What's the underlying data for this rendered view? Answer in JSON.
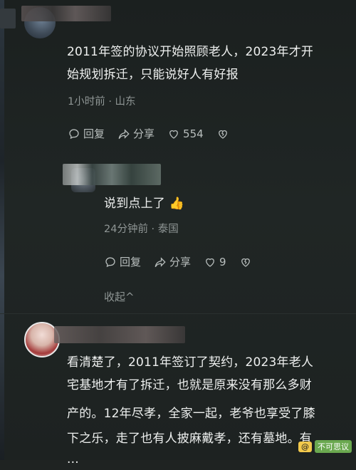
{
  "comments": [
    {
      "lines": [
        "2011年签的协议开始照顾老人，2023年才开",
        "始规划拆迁，只能说好人有好报"
      ],
      "meta": "1小时前 · 山东",
      "actions": {
        "reply": "回复",
        "share": "分享",
        "likes": "554"
      },
      "reply": {
        "lines": [
          "说到点上了 👍"
        ],
        "meta": "24分钟前 · 泰国",
        "actions": {
          "reply": "回复",
          "share": "分享",
          "likes": "9"
        }
      },
      "collapse": "收起^"
    },
    {
      "lines": [
        "看清楚了，2011年签订了契约，2023年老人",
        "宅基地才有了拆迁，也就是原来没有那么多财",
        "产的。12年尽孝，全家一起，老爷也享受了膝",
        "下之乐，走了也有人披麻戴孝，还有墓地。有",
        "..."
      ]
    }
  ],
  "watermark": {
    "badge": "@",
    "name": "不可思议"
  },
  "colors": {
    "background": "#1f2322",
    "text": "#eef0ef",
    "meta": "#8f9695",
    "action": "#b9bfbe"
  },
  "icons": {
    "reply": "reply-bubble-icon",
    "share": "share-arrow-icon",
    "like": "heart-icon",
    "dislike": "broken-heart-icon"
  }
}
